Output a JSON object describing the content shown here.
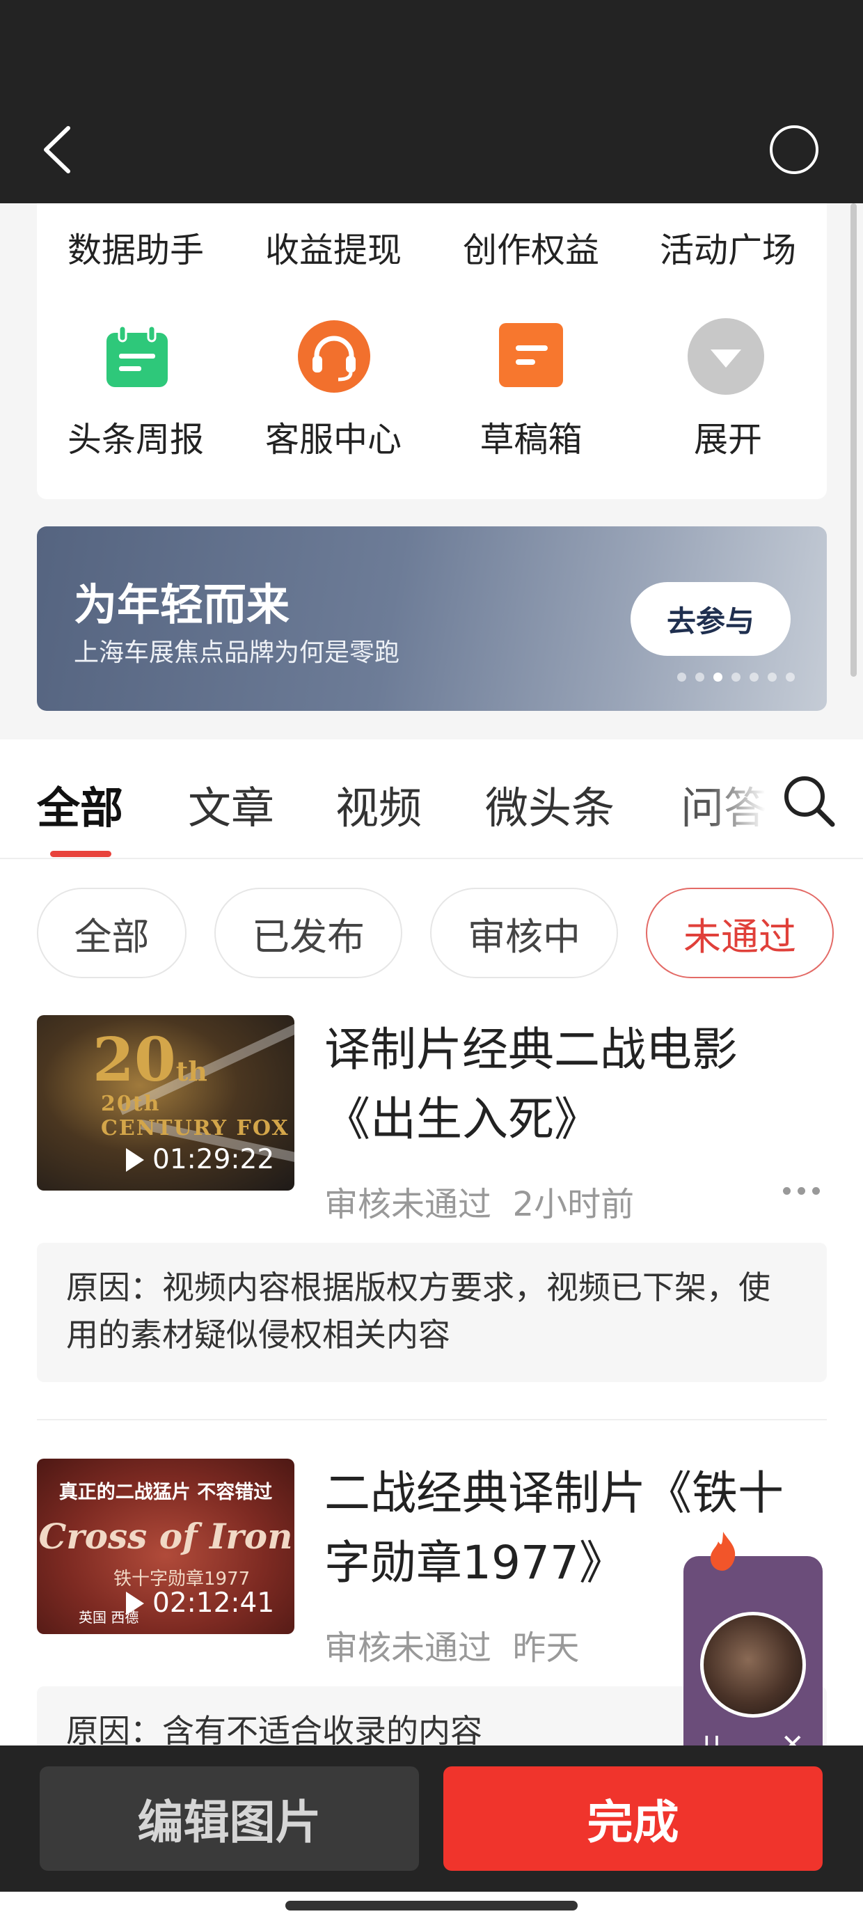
{
  "header": {
    "back_icon": "chevron-left-icon",
    "right_icon": "circle-icon"
  },
  "grid": {
    "row1": [
      "数据助手",
      "收益提现",
      "创作权益",
      "活动广场"
    ],
    "row2": [
      {
        "label": "头条周报",
        "icon": "calendar-icon",
        "color": "#2ec87a"
      },
      {
        "label": "客服中心",
        "icon": "headset-icon",
        "color": "#f2702d"
      },
      {
        "label": "草稿箱",
        "icon": "draft-icon",
        "color": "#f7772e"
      },
      {
        "label": "展开",
        "icon": "expand-down-icon",
        "color": "#c8c8c8"
      }
    ]
  },
  "banner": {
    "title": "为年轻而来",
    "subtitle": "上海车展焦点品牌为何是零跑",
    "button": "去参与",
    "dot_count": 7,
    "active_dot": 3
  },
  "tabs": {
    "items": [
      "全部",
      "文章",
      "视频",
      "微头条",
      "问答"
    ],
    "active_index": 0
  },
  "filters": {
    "items": [
      "全部",
      "已发布",
      "审核中",
      "未通过"
    ],
    "active_index": 3
  },
  "items": [
    {
      "title": "译制片经典二战电影《出生入死》",
      "status": "审核未通过",
      "time": "2小时前",
      "duration": "01:29:22",
      "reason": "原因：视频内容根据版权方要求，视频已下架，使用的素材疑似侵权相关内容",
      "thumb_text": "20th CENTURY FOX"
    },
    {
      "title": "二战经典译制片《铁十字勋章1977》",
      "status": "审核未通过",
      "time": "昨天",
      "duration": "02:12:41",
      "reason": "原因：含有不适合收录的内容",
      "thumb_text": "真正的二战猛片 不容错过",
      "thumb_logo": "Cross of Iron",
      "thumb_sub": "铁十字勋章1977",
      "thumb_foot": "英国 西德"
    }
  ],
  "mini_player": {
    "pause": "II",
    "close": "✕"
  },
  "bottom": {
    "edit": "编辑图片",
    "done": "完成"
  }
}
